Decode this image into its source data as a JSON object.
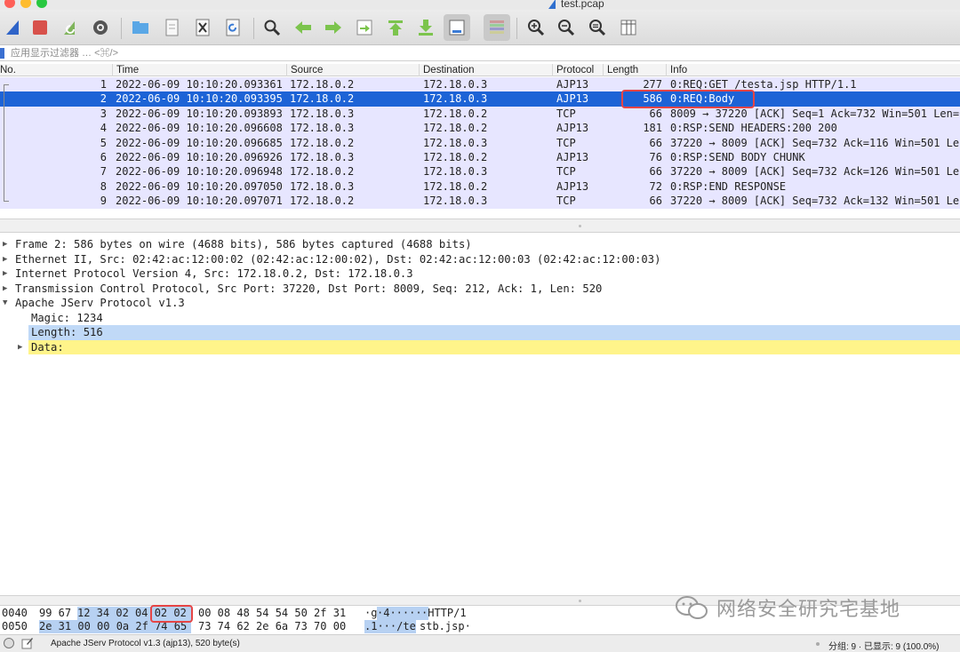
{
  "window": {
    "title": "test.pcap"
  },
  "toolbar": {
    "buttons": [
      "shark-fin-start-icon",
      "stop-capture-icon",
      "restart-capture-icon",
      "capture-options-icon",
      "open-file-icon",
      "file-icon",
      "close-file-icon",
      "reload-file-icon",
      "find-packet-icon",
      "go-back-icon",
      "go-forward-icon",
      "go-to-packet-icon",
      "first-packet-icon",
      "last-packet-icon",
      "autoscroll-icon",
      "colorize-icon",
      "zoom-in-icon",
      "zoom-out-icon",
      "zoom-normal-icon",
      "resize-columns-icon"
    ]
  },
  "filter": {
    "placeholder": "应用显示过滤器 … <⌘/>"
  },
  "packet_list": {
    "columns": [
      "No.",
      "Time",
      "Source",
      "Destination",
      "Protocol",
      "Length",
      "Info"
    ],
    "rows": [
      {
        "no": "1",
        "time": "2022-06-09 10:10:20.093361",
        "source": "172.18.0.2",
        "destination": "172.18.0.3",
        "protocol": "AJP13",
        "length": "277",
        "info": "0:REQ:GET /testa.jsp HTTP/1.1"
      },
      {
        "no": "2",
        "time": "2022-06-09 10:10:20.093395",
        "source": "172.18.0.2",
        "destination": "172.18.0.3",
        "protocol": "AJP13",
        "length": "586",
        "info": "0:REQ:Body"
      },
      {
        "no": "3",
        "time": "2022-06-09 10:10:20.093893",
        "source": "172.18.0.3",
        "destination": "172.18.0.2",
        "protocol": "TCP",
        "length": "66",
        "info": "8009 → 37220 [ACK] Seq=1 Ack=732 Win=501 Len=0"
      },
      {
        "no": "4",
        "time": "2022-06-09 10:10:20.096608",
        "source": "172.18.0.3",
        "destination": "172.18.0.2",
        "protocol": "AJP13",
        "length": "181",
        "info": "0:RSP:SEND HEADERS:200 200"
      },
      {
        "no": "5",
        "time": "2022-06-09 10:10:20.096685",
        "source": "172.18.0.2",
        "destination": "172.18.0.3",
        "protocol": "TCP",
        "length": "66",
        "info": "37220 → 8009 [ACK] Seq=732 Ack=116 Win=501 Len=0"
      },
      {
        "no": "6",
        "time": "2022-06-09 10:10:20.096926",
        "source": "172.18.0.3",
        "destination": "172.18.0.2",
        "protocol": "AJP13",
        "length": "76",
        "info": "0:RSP:SEND BODY CHUNK"
      },
      {
        "no": "7",
        "time": "2022-06-09 10:10:20.096948",
        "source": "172.18.0.2",
        "destination": "172.18.0.3",
        "protocol": "TCP",
        "length": "66",
        "info": "37220 → 8009 [ACK] Seq=732 Ack=126 Win=501 Len=0"
      },
      {
        "no": "8",
        "time": "2022-06-09 10:10:20.097050",
        "source": "172.18.0.3",
        "destination": "172.18.0.2",
        "protocol": "AJP13",
        "length": "72",
        "info": "0:RSP:END RESPONSE"
      },
      {
        "no": "9",
        "time": "2022-06-09 10:10:20.097071",
        "source": "172.18.0.2",
        "destination": "172.18.0.3",
        "protocol": "TCP",
        "length": "66",
        "info": "37220 → 8009 [ACK] Seq=732 Ack=132 Win=501 Len=0"
      }
    ],
    "selected_row": 2
  },
  "details": {
    "rows": [
      {
        "text": "Frame 2: 586 bytes on wire (4688 bits), 586 bytes captured (4688 bits)",
        "level": 0,
        "expand": "collapsed"
      },
      {
        "text": "Ethernet II, Src: 02:42:ac:12:00:02 (02:42:ac:12:00:02), Dst: 02:42:ac:12:00:03 (02:42:ac:12:00:03)",
        "level": 0,
        "expand": "collapsed"
      },
      {
        "text": "Internet Protocol Version 4, Src: 172.18.0.2, Dst: 172.18.0.3",
        "level": 0,
        "expand": "collapsed"
      },
      {
        "text": "Transmission Control Protocol, Src Port: 37220, Dst Port: 8009, Seq: 212, Ack: 1, Len: 520",
        "level": 0,
        "expand": "collapsed"
      },
      {
        "text": "Apache JServ Protocol v1.3",
        "level": 0,
        "expand": "expanded"
      },
      {
        "text": "Magic: 1234",
        "level": 1,
        "expand": "none"
      },
      {
        "text": "Length: 516",
        "level": 1,
        "expand": "none",
        "highlight": "blue"
      },
      {
        "text": "Data:",
        "level": 1,
        "expand": "collapsed",
        "highlight": "yellow"
      }
    ]
  },
  "bytes": {
    "rows": [
      {
        "offset": "0040",
        "pre": "99 67",
        "hex_hl": "12 34 02 04 02 02",
        "hex_rest": "00 08 48 54 54 50 2f 31",
        "ascii_pre": "·g",
        "ascii_hl": "·4·····",
        "ascii_rest": "·HTTP/1"
      },
      {
        "offset": "0050",
        "pre": "",
        "hex_hl": "2e 31 00 00 0a 2f 74 65",
        "hex_rest": "73 74 62 2e 6a 73 70 00",
        "ascii_pre": "",
        "ascii_hl": ".1···/te",
        "ascii_rest": "stb.jsp·"
      }
    ]
  },
  "status": {
    "left": "Apache JServ Protocol v1.3 (ajp13), 520 byte(s)",
    "right": "分组: 9 · 已显示: 9 (100.0%)"
  },
  "watermark": {
    "text": "网络安全研究宅基地"
  },
  "colors": {
    "row_bg": "#e7e6ff",
    "selected_bg": "#1d63d6",
    "highlight_blue": "#c0d9f7",
    "highlight_yellow": "#fff48a",
    "annotation_red": "#e64545"
  }
}
